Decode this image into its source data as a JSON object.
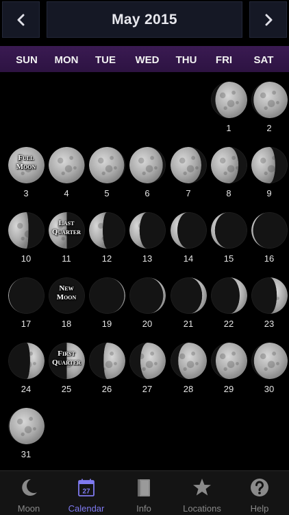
{
  "header": {
    "month_title": "May 2015"
  },
  "weekdays": [
    "SUN",
    "MON",
    "TUE",
    "WED",
    "THU",
    "FRI",
    "SAT"
  ],
  "calendar": {
    "first_weekday_index": 5,
    "days": [
      {
        "day": "1",
        "illum": 0.88,
        "waxing": true,
        "label": ""
      },
      {
        "day": "2",
        "illum": 0.94,
        "waxing": true,
        "label": ""
      },
      {
        "day": "3",
        "illum": 1.0,
        "waxing": true,
        "label": "Full Moon"
      },
      {
        "day": "4",
        "illum": 0.99,
        "waxing": false,
        "label": ""
      },
      {
        "day": "5",
        "illum": 0.97,
        "waxing": false,
        "label": ""
      },
      {
        "day": "6",
        "illum": 0.92,
        "waxing": false,
        "label": ""
      },
      {
        "day": "7",
        "illum": 0.85,
        "waxing": false,
        "label": ""
      },
      {
        "day": "8",
        "illum": 0.76,
        "waxing": false,
        "label": ""
      },
      {
        "day": "9",
        "illum": 0.66,
        "waxing": false,
        "label": ""
      },
      {
        "day": "10",
        "illum": 0.56,
        "waxing": false,
        "label": ""
      },
      {
        "day": "11",
        "illum": 0.5,
        "waxing": false,
        "label": "Last Quarter"
      },
      {
        "day": "12",
        "illum": 0.38,
        "waxing": false,
        "label": ""
      },
      {
        "day": "13",
        "illum": 0.28,
        "waxing": false,
        "label": ""
      },
      {
        "day": "14",
        "illum": 0.19,
        "waxing": false,
        "label": ""
      },
      {
        "day": "15",
        "illum": 0.11,
        "waxing": false,
        "label": ""
      },
      {
        "day": "16",
        "illum": 0.05,
        "waxing": false,
        "label": ""
      },
      {
        "day": "17",
        "illum": 0.02,
        "waxing": false,
        "label": ""
      },
      {
        "day": "18",
        "illum": 0.0,
        "waxing": true,
        "label": "New Moon"
      },
      {
        "day": "19",
        "illum": 0.03,
        "waxing": true,
        "label": ""
      },
      {
        "day": "20",
        "illum": 0.07,
        "waxing": true,
        "label": ""
      },
      {
        "day": "21",
        "illum": 0.13,
        "waxing": true,
        "label": ""
      },
      {
        "day": "22",
        "illum": 0.21,
        "waxing": true,
        "label": ""
      },
      {
        "day": "23",
        "illum": 0.3,
        "waxing": true,
        "label": ""
      },
      {
        "day": "24",
        "illum": 0.4,
        "waxing": true,
        "label": ""
      },
      {
        "day": "25",
        "illum": 0.5,
        "waxing": true,
        "label": "First Quarter"
      },
      {
        "day": "26",
        "illum": 0.6,
        "waxing": true,
        "label": ""
      },
      {
        "day": "27",
        "illum": 0.7,
        "waxing": true,
        "label": ""
      },
      {
        "day": "28",
        "illum": 0.79,
        "waxing": true,
        "label": ""
      },
      {
        "day": "29",
        "illum": 0.87,
        "waxing": true,
        "label": ""
      },
      {
        "day": "30",
        "illum": 0.93,
        "waxing": true,
        "label": ""
      },
      {
        "day": "31",
        "illum": 0.97,
        "waxing": true,
        "label": ""
      }
    ]
  },
  "tabs": [
    {
      "label": "Moon",
      "icon": "crescent-moon-icon",
      "active": false
    },
    {
      "label": "Calendar",
      "icon": "calendar-icon",
      "calendar_icon_number": "27",
      "active": true
    },
    {
      "label": "Info",
      "icon": "book-icon",
      "active": false
    },
    {
      "label": "Locations",
      "icon": "star-icon",
      "active": false
    },
    {
      "label": "Help",
      "icon": "help-icon",
      "active": false
    }
  ],
  "colors": {
    "accent": "#7f7af0",
    "weekday_bar": "#3a1a52",
    "header_button": "#151825",
    "tab_inactive": "#8a8a8a"
  }
}
